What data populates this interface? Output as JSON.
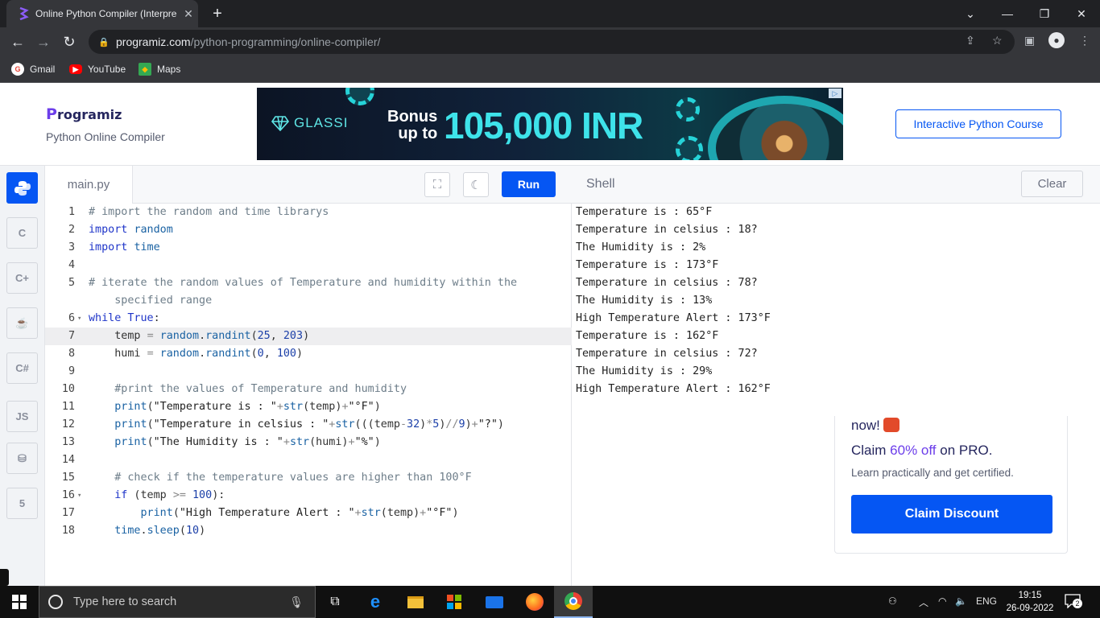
{
  "browser": {
    "tab_title": "Online Python Compiler (Interpre",
    "tab_close": "✕",
    "new_tab": "+",
    "url_host": "programiz.com",
    "url_path": "/python-programming/online-compiler/",
    "bookmarks": [
      {
        "label": "Gmail",
        "icon": "google-icon",
        "color": "#ea4335"
      },
      {
        "label": "YouTube",
        "icon": "youtube-icon",
        "color": "#ff0000"
      },
      {
        "label": "Maps",
        "icon": "maps-icon",
        "color": "#34a853"
      }
    ]
  },
  "header": {
    "logo": "rogramiz",
    "logo_p": "P",
    "subtitle": "Python Online Compiler",
    "course_button": "Interactive Python Course"
  },
  "ad": {
    "brand": "GLASSI",
    "bonus_line1": "Bonus",
    "bonus_line2": "up to",
    "amount": "105,000 INR"
  },
  "rail": {
    "items": [
      {
        "name": "python",
        "icon": "python-icon",
        "active": true
      },
      {
        "name": "c",
        "icon": "c-icon"
      },
      {
        "name": "cpp",
        "icon": "cpp-icon"
      },
      {
        "name": "java",
        "icon": "java-icon"
      },
      {
        "name": "csharp",
        "icon": "csharp-icon"
      },
      {
        "name": "js",
        "label": "JS",
        "icon": "js-icon"
      },
      {
        "name": "sql",
        "icon": "database-icon"
      },
      {
        "name": "html",
        "icon": "html5-icon"
      }
    ]
  },
  "editor": {
    "file_name": "main.py",
    "run_label": "Run",
    "active_line": 7,
    "lines": [
      {
        "n": "1",
        "text": "# import the random and time librarys"
      },
      {
        "n": "2",
        "text": "import random"
      },
      {
        "n": "3",
        "text": "import time"
      },
      {
        "n": "4",
        "text": ""
      },
      {
        "n": "5",
        "text": "# iterate the random values of Temperature and humidity within the"
      },
      {
        "n": "",
        "text": "    specified range"
      },
      {
        "n": "6",
        "text": "while True:",
        "fold": true
      },
      {
        "n": "7",
        "text": "    temp = random.randint(25, 203)"
      },
      {
        "n": "8",
        "text": "    humi = random.randint(0, 100)"
      },
      {
        "n": "9",
        "text": ""
      },
      {
        "n": "10",
        "text": "    #print the values of Temperature and humidity"
      },
      {
        "n": "11",
        "text": "    print(\"Temperature is : \"+str(temp)+\"°F\")"
      },
      {
        "n": "12",
        "text": "    print(\"Temperature in celsius : \"+str(((temp-32)*5)//9)+\"?\")"
      },
      {
        "n": "13",
        "text": "    print(\"The Humidity is : \"+str(humi)+\"%\")"
      },
      {
        "n": "14",
        "text": ""
      },
      {
        "n": "15",
        "text": "    # check if the temperature values are higher than 100°F"
      },
      {
        "n": "16",
        "text": "    if (temp >= 100):",
        "fold": true
      },
      {
        "n": "17",
        "text": "        print(\"High Temperature Alert : \"+str(temp)+\"°F\")"
      },
      {
        "n": "18",
        "text": "    time.sleep(10)"
      }
    ]
  },
  "shell": {
    "title": "Shell",
    "clear_label": "Clear",
    "output": [
      "Temperature is : 65°F",
      "Temperature in celsius : 18?",
      "The Humidity is : 2%",
      "Temperature is : 173°F",
      "Temperature in celsius : 78?",
      "The Humidity is : 13%",
      "High Temperature Alert : 173°F",
      "Temperature is : 162°F",
      "Temperature in celsius : 72?",
      "The Humidity is : 29%",
      "High Temperature Alert : 162°F"
    ]
  },
  "promo": {
    "now": "now!",
    "claim_prefix": "Claim ",
    "claim_highlight": "60% off",
    "claim_suffix": " on PRO.",
    "learn": "Learn practically and get certified.",
    "button": "Claim Discount"
  },
  "taskbar": {
    "search_placeholder": "Type here to search",
    "language": "ENG",
    "time": "19:15",
    "date": "26-09-2022",
    "notifications": "2"
  }
}
